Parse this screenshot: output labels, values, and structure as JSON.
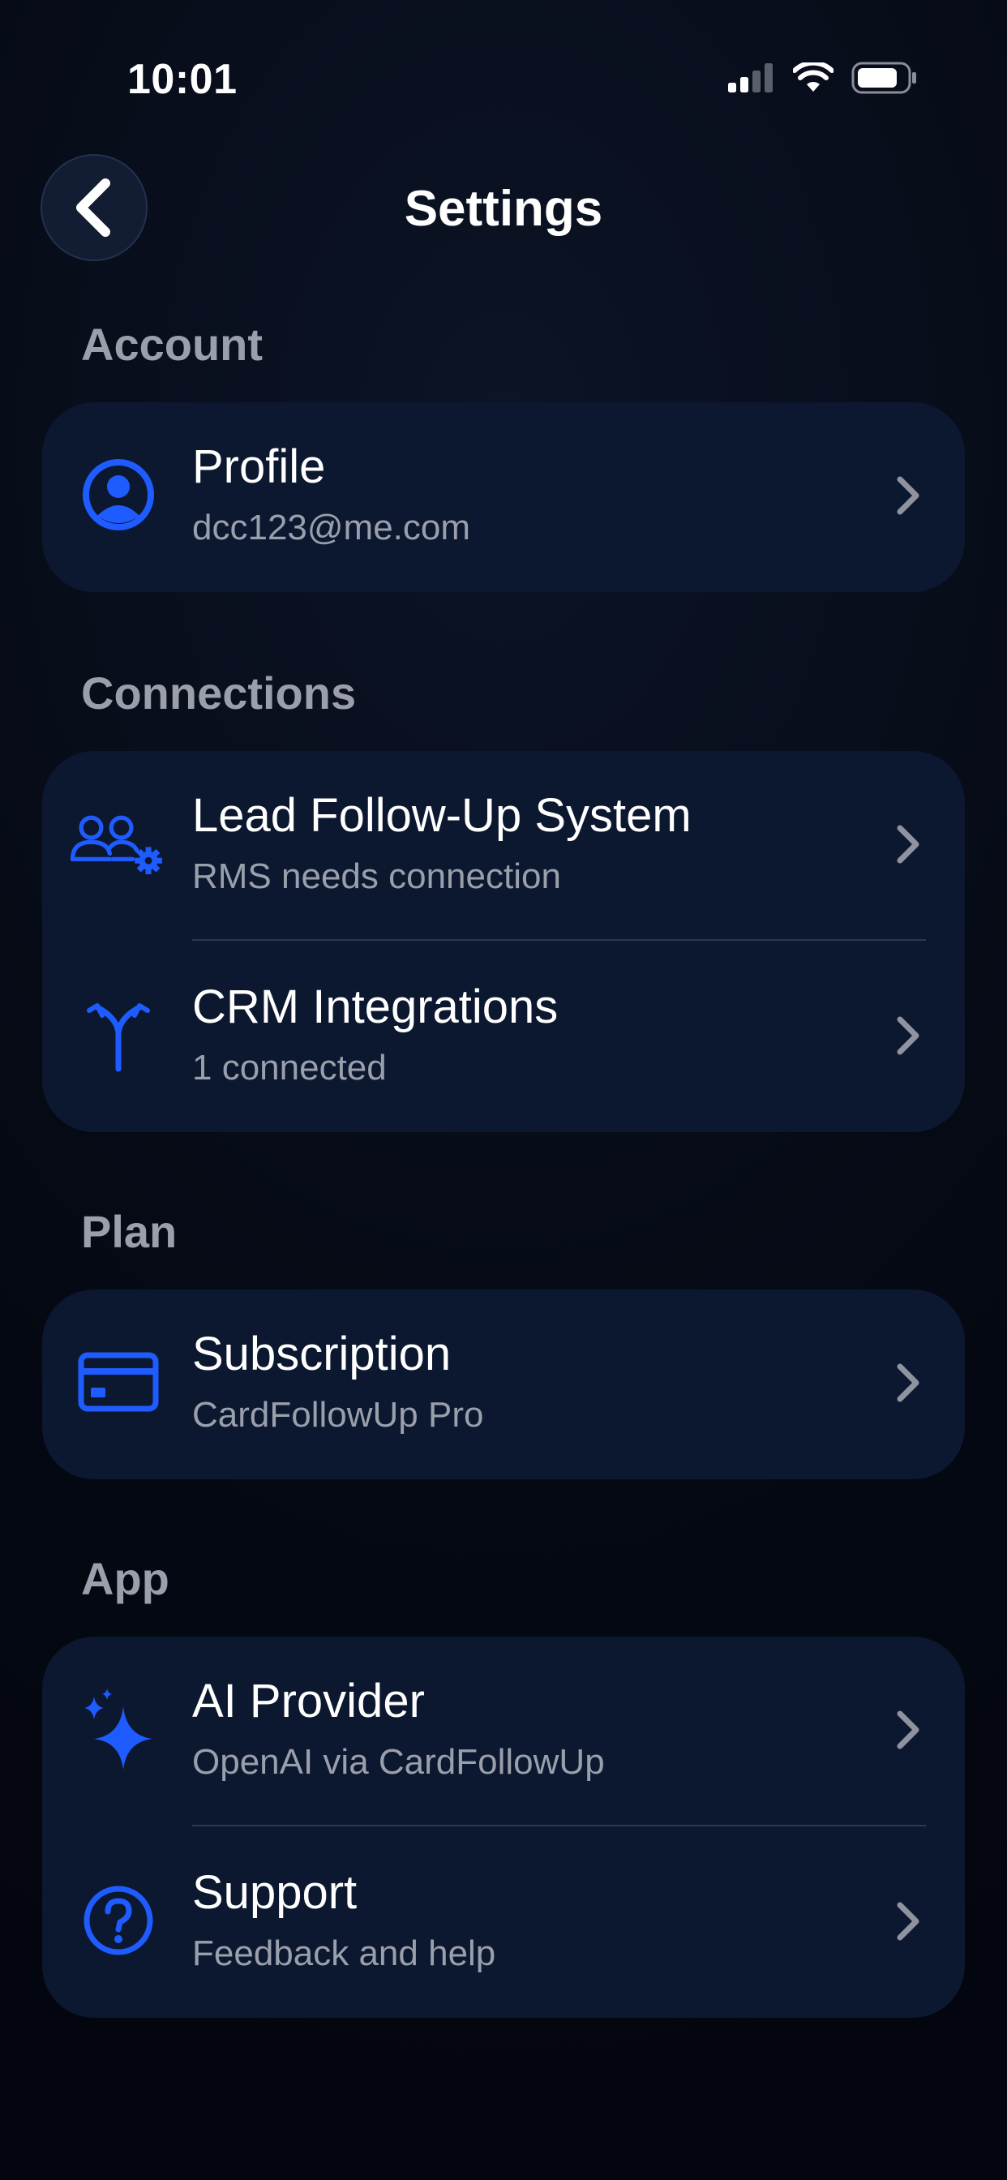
{
  "status": {
    "time": "10:01"
  },
  "header": {
    "title": "Settings"
  },
  "sections": {
    "account": {
      "label": "Account",
      "items": [
        {
          "title": "Profile",
          "subtitle": "dcc123@me.com",
          "icon": "person-circle-icon"
        }
      ]
    },
    "connections": {
      "label": "Connections",
      "items": [
        {
          "title": "Lead Follow-Up System",
          "subtitle": "RMS needs connection",
          "icon": "users-gear-icon"
        },
        {
          "title": "CRM Integrations",
          "subtitle": "1 connected",
          "icon": "branch-icon"
        }
      ]
    },
    "plan": {
      "label": "Plan",
      "items": [
        {
          "title": "Subscription",
          "subtitle": "CardFollowUp Pro",
          "icon": "credit-card-icon"
        }
      ]
    },
    "app": {
      "label": "App",
      "items": [
        {
          "title": "AI Provider",
          "subtitle": "OpenAI via CardFollowUp",
          "icon": "sparkles-icon"
        },
        {
          "title": "Support",
          "subtitle": "Feedback and help",
          "icon": "question-circle-icon"
        }
      ]
    }
  },
  "colors": {
    "accent": "#1f5cff",
    "card": "#0c1830",
    "section_label": "#9b9eab",
    "subtitle": "#9a9fac"
  }
}
